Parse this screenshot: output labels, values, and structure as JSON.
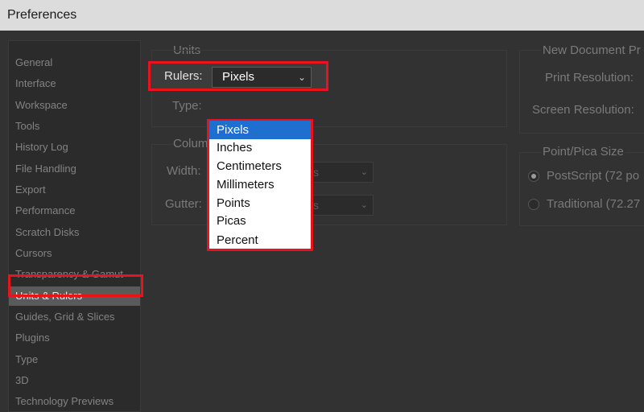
{
  "window": {
    "title": "Preferences"
  },
  "sidebar": {
    "items": [
      {
        "label": "General"
      },
      {
        "label": "Interface"
      },
      {
        "label": "Workspace"
      },
      {
        "label": "Tools"
      },
      {
        "label": "History Log"
      },
      {
        "label": "File Handling"
      },
      {
        "label": "Export"
      },
      {
        "label": "Performance"
      },
      {
        "label": "Scratch Disks"
      },
      {
        "label": "Cursors"
      },
      {
        "label": "Transparency & Gamut"
      },
      {
        "label": "Units & Rulers"
      },
      {
        "label": "Guides, Grid & Slices"
      },
      {
        "label": "Plugins"
      },
      {
        "label": "Type"
      },
      {
        "label": "3D"
      },
      {
        "label": "Technology Previews"
      }
    ],
    "selected": "Units & Rulers"
  },
  "units": {
    "title": "Units",
    "rulers_label": "Rulers:",
    "rulers_value": "Pixels",
    "type_label": "Type:",
    "rulers_options": [
      "Pixels",
      "Inches",
      "Centimeters",
      "Millimeters",
      "Points",
      "Picas",
      "Percent"
    ],
    "rulers_selected": "Pixels"
  },
  "columns": {
    "title": "Colum",
    "width_label": "Width:",
    "width_unit": "s",
    "gutter_label": "Gutter:",
    "gutter_unit": "s"
  },
  "new_document": {
    "title": "New Document Pr",
    "print_resolution_label": "Print Resolution:",
    "screen_resolution_label": "Screen Resolution:"
  },
  "point_pica": {
    "title": "Point/Pica Size",
    "options": [
      {
        "label": "PostScript (72 po",
        "checked": true
      },
      {
        "label": "Traditional (72.27",
        "checked": false
      }
    ]
  },
  "colors": {
    "highlight_red": "#e8141c",
    "selection_blue": "#1e6fd0",
    "sidebar_selected": "#5a5a5a"
  }
}
